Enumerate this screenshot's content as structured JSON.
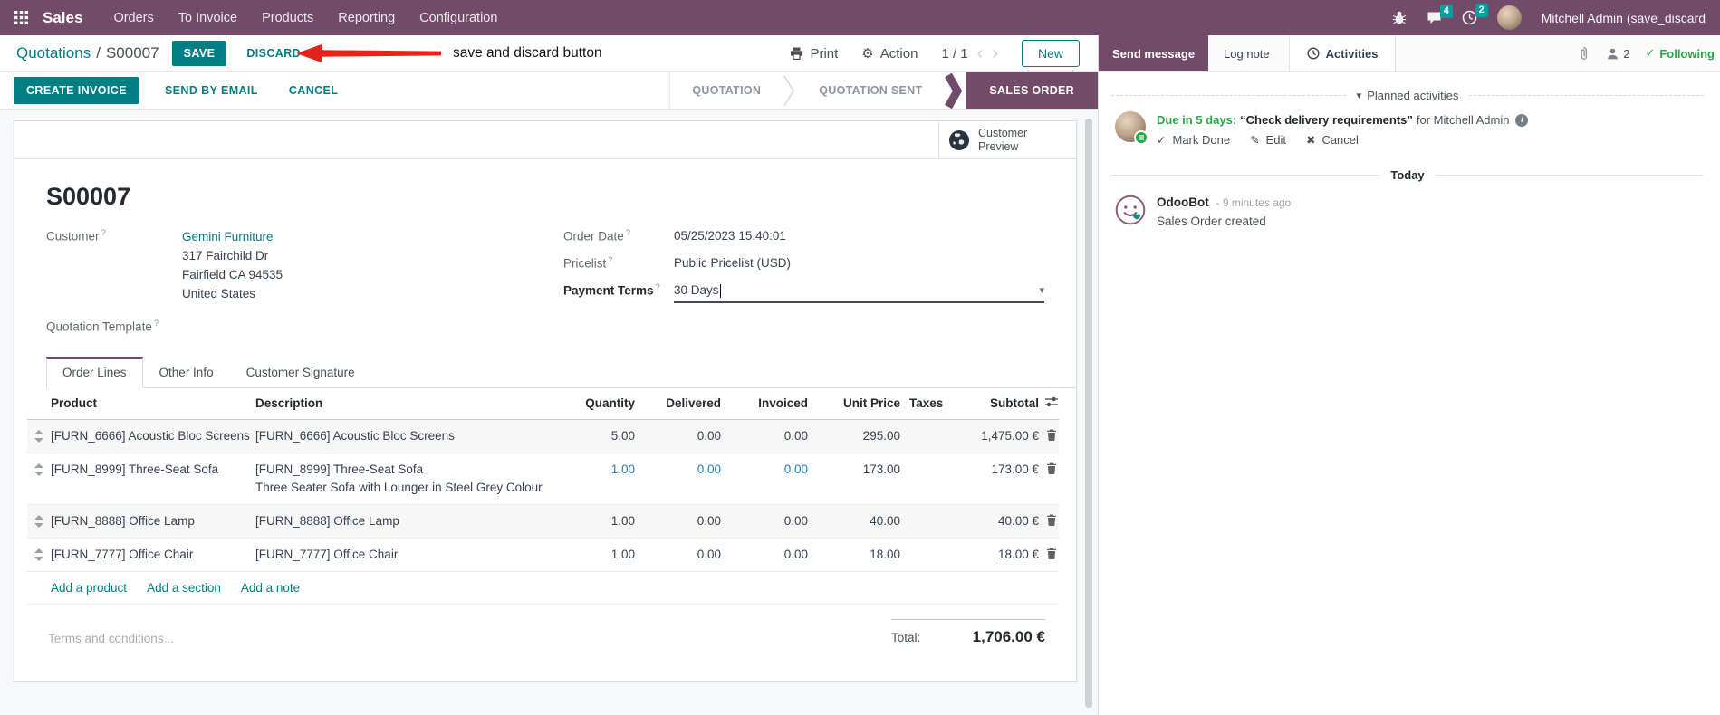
{
  "colors": {
    "purple": "#714B67",
    "teal": "#017e84",
    "badge_teal": "#00A09D",
    "green": "#28a745",
    "red": "#e3241b",
    "edited_blue": "#2380b8"
  },
  "icons": {
    "prev_page": "‹",
    "next_page": "›",
    "gear": "⚙",
    "caret_down": "▾",
    "dropdown_caret": "▾",
    "check": "✓",
    "edit_pencil": "✎",
    "cancel_cross": "✖",
    "info_letter": "i"
  },
  "nav": {
    "brand": "Sales",
    "items": [
      "Orders",
      "To Invoice",
      "Products",
      "Reporting",
      "Configuration"
    ],
    "messages_badge": "4",
    "activities_badge": "2",
    "user_name": "Mitchell Admin (save_discard"
  },
  "control": {
    "breadcrumb_parent": "Quotations",
    "breadcrumb_separator": "/",
    "breadcrumb_current": "S00007",
    "save": "SAVE",
    "discard": "DISCARD",
    "print": "Print",
    "action": "Action",
    "pager": "1 / 1",
    "new": "New"
  },
  "annotation": {
    "text": "save and discard button"
  },
  "statusbar": {
    "buttons": [
      "CREATE INVOICE",
      "SEND BY EMAIL",
      "CANCEL"
    ],
    "stages": [
      "QUOTATION",
      "QUOTATION SENT",
      "SALES ORDER"
    ]
  },
  "form": {
    "preview_label": "Customer Preview",
    "title": "S00007",
    "help": "?",
    "customer_label": "Customer",
    "customer_name": "Gemini Furniture",
    "address_line1": "317 Fairchild Dr",
    "address_line2": "Fairfield CA 94535",
    "address_line3": "United States",
    "quotation_template_label": "Quotation Template",
    "order_date_label": "Order Date",
    "order_date": "05/25/2023 15:40:01",
    "pricelist_label": "Pricelist",
    "pricelist": "Public Pricelist (USD)",
    "payment_terms_label": "Payment Terms",
    "payment_terms": "30 Days",
    "tabs": [
      "Order Lines",
      "Other Info",
      "Customer Signature"
    ],
    "table": {
      "columns": [
        "Product",
        "Description",
        "Quantity",
        "Delivered",
        "Invoiced",
        "Unit Price",
        "Taxes",
        "Subtotal"
      ],
      "rows": [
        {
          "product": "[FURN_6666] Acoustic Bloc Screens",
          "desc1": "[FURN_6666] Acoustic Bloc Screens",
          "qty": "5.00",
          "delivered": "0.00",
          "invoiced": "0.00",
          "price": "295.00",
          "taxes": "",
          "subtotal": "1,475.00 €"
        },
        {
          "product": "[FURN_8999] Three-Seat Sofa",
          "desc1": "[FURN_8999] Three-Seat Sofa",
          "desc2": "Three Seater Sofa with Lounger in Steel Grey Colour",
          "qty": "1.00",
          "delivered": "0.00",
          "invoiced": "0.00",
          "price": "173.00",
          "taxes": "",
          "subtotal": "173.00 €"
        },
        {
          "product": "[FURN_8888] Office Lamp",
          "desc1": "[FURN_8888] Office Lamp",
          "qty": "1.00",
          "delivered": "0.00",
          "invoiced": "0.00",
          "price": "40.00",
          "taxes": "",
          "subtotal": "40.00 €"
        },
        {
          "product": "[FURN_7777] Office Chair",
          "desc1": "[FURN_7777] Office Chair",
          "qty": "1.00",
          "delivered": "0.00",
          "invoiced": "0.00",
          "price": "18.00",
          "taxes": "",
          "subtotal": "18.00 €"
        }
      ],
      "links": [
        "Add a product",
        "Add a section",
        "Add a note"
      ]
    },
    "terms_placeholder": "Terms and conditions...",
    "total_label": "Total:",
    "total_value": "1,706.00 €"
  },
  "chatter": {
    "send_message": "Send message",
    "log_note": "Log note",
    "activities": "Activities",
    "followers_count": "2",
    "following": "Following",
    "planned_header": "Planned activities",
    "activity": {
      "due": "Due in 5 days:",
      "title": "“Check delivery requirements”",
      "assignee": "for Mitchell Admin",
      "mark_done": "Mark Done",
      "edit": "Edit",
      "cancel": "Cancel"
    },
    "today": "Today",
    "message": {
      "author": "OdooBot",
      "time": "- 9 minutes ago",
      "body": "Sales Order created"
    }
  }
}
